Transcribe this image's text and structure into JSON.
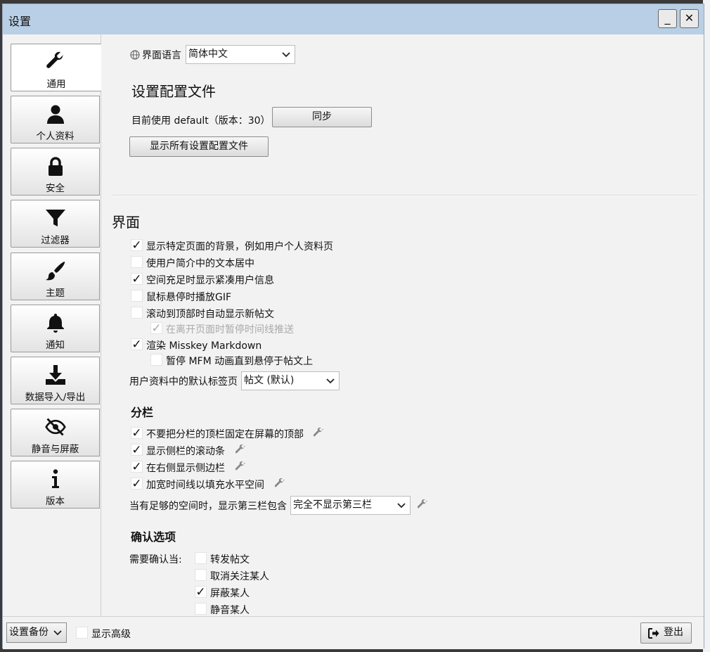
{
  "window": {
    "title": "设置",
    "minimize_label": "_",
    "close_label": "✕"
  },
  "sidebar": {
    "items": [
      {
        "label": "通用",
        "icon": "wrench-icon",
        "active": true
      },
      {
        "label": "个人资料",
        "icon": "user-icon"
      },
      {
        "label": "安全",
        "icon": "lock-icon"
      },
      {
        "label": "过滤器",
        "icon": "filter-icon"
      },
      {
        "label": "主题",
        "icon": "paintbrush-icon"
      },
      {
        "label": "通知",
        "icon": "bell-icon"
      },
      {
        "label": "数据导入/导出",
        "icon": "download-icon"
      },
      {
        "label": "静音与屏蔽",
        "icon": "eye-slash-icon"
      },
      {
        "label": "版本",
        "icon": "info-icon"
      }
    ]
  },
  "main": {
    "language": {
      "label": "界面语言",
      "value": "简体中文"
    },
    "profile": {
      "heading": "设置配置文件",
      "current_text": "目前使用 default（版本：30）",
      "sync_label": "同步",
      "show_all_label": "显示所有设置配置文件"
    },
    "ui": {
      "heading": "界面",
      "options": [
        {
          "label": "显示特定页面的背景，例如用户个人资料页",
          "checked": true
        },
        {
          "label": "使用户简介中的文本居中",
          "checked": false
        },
        {
          "label": "空间充足时显示紧凑用户信息",
          "checked": true
        },
        {
          "label": "鼠标悬停时播放GIF",
          "checked": false
        },
        {
          "label": "滚动到顶部时自动显示新帖文",
          "checked": false
        },
        {
          "label": "在离开页面时暂停时间线推送",
          "checked": true,
          "disabled": true
        },
        {
          "label": "渲染 Misskey Markdown",
          "checked": true
        },
        {
          "label": "暂停 MFM 动画直到悬停于帖文上",
          "checked": false
        }
      ],
      "default_tab_label": "用户资料中的默认标签页",
      "default_tab_value": "帖文 (默认)"
    },
    "columns": {
      "heading": "分栏",
      "options": [
        {
          "label": "不要把分栏的顶栏固定在屏幕的顶部",
          "checked": true
        },
        {
          "label": "显示侧栏的滚动条",
          "checked": true
        },
        {
          "label": "在右侧显示侧边栏",
          "checked": true
        },
        {
          "label": "加宽时间线以填充水平空间",
          "checked": true
        }
      ],
      "third_column_label": "当有足够的空间时，显示第三栏包含",
      "third_column_value": "完全不显示第三栏"
    },
    "confirm": {
      "heading": "确认选项",
      "need_label": "需要确认当:",
      "options": [
        {
          "label": "转发帖文",
          "checked": false
        },
        {
          "label": "取消关注某人",
          "checked": false
        },
        {
          "label": "屏蔽某人",
          "checked": true
        },
        {
          "label": "静音某人",
          "checked": false
        }
      ]
    }
  },
  "bottom": {
    "backup_label": "设置备份",
    "advanced_label": "显示高级",
    "advanced_checked": false,
    "logout_label": "登出"
  },
  "checkmark": "✓"
}
